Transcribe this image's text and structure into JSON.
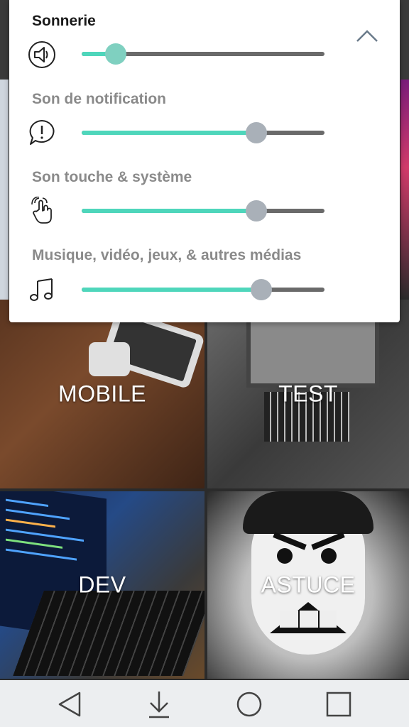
{
  "volume_panel": {
    "rows": [
      {
        "title": "Sonnerie",
        "icon": "speaker-icon",
        "level": 0.14,
        "active": true
      },
      {
        "title": "Son de notification",
        "icon": "notification-icon",
        "level": 0.72,
        "active": false
      },
      {
        "title": "Son touche & système",
        "icon": "touch-icon",
        "level": 0.72,
        "active": false
      },
      {
        "title": "Musique, vidéo, jeux, & autres médias",
        "icon": "music-icon",
        "level": 0.74,
        "active": false
      }
    ],
    "collapse_icon": "chevron-up-icon",
    "colors": {
      "fill": "#4ed6bb",
      "track": "#6a6a6a",
      "thumb_active": "#7fd0c0",
      "thumb": "#a9b0b8"
    }
  },
  "tiles": [
    {
      "label": "MOBILE"
    },
    {
      "label": "TEST"
    },
    {
      "label": "DEV"
    },
    {
      "label": "ASTUCE"
    }
  ],
  "navbar": {
    "buttons": [
      "back-icon",
      "download-icon",
      "home-icon",
      "recents-icon"
    ]
  }
}
